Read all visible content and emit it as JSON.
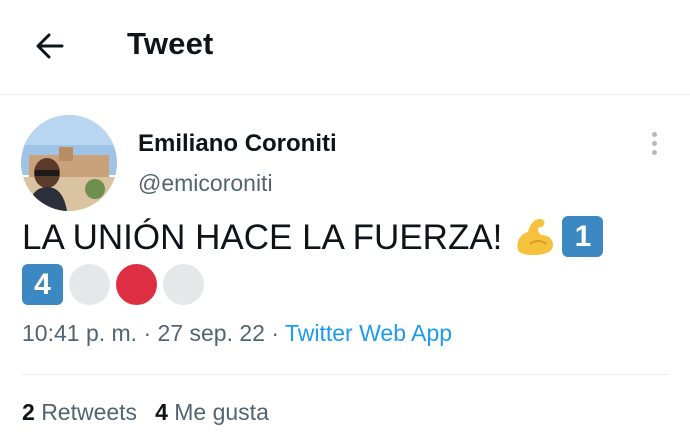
{
  "header": {
    "title": "Tweet",
    "back_icon": "arrow-left-icon"
  },
  "author": {
    "display_name": "Emiliano Coroniti",
    "handle": "@emicoroniti"
  },
  "tweet": {
    "text_line1": "LA UNIÓN HACE LA FUERZA!",
    "keycap_1": "1",
    "keycap_2": "4",
    "emojis": [
      "flexed-biceps",
      "keycap-1",
      "keycap-4",
      "white-circle",
      "red-circle",
      "white-circle"
    ]
  },
  "meta": {
    "time": "10:41 p. m.",
    "separator": " · ",
    "date": "27 sep. 22",
    "source": "Twitter Web App"
  },
  "stats": {
    "retweets_count": "2",
    "retweets_label": "Retweets",
    "likes_count": "4",
    "likes_label": "Me gusta"
  },
  "colors": {
    "link": "#1d9bf0",
    "secondary_text": "#536471",
    "keycap_blue": "#3b88c3",
    "red_circle": "#dd2e44"
  }
}
